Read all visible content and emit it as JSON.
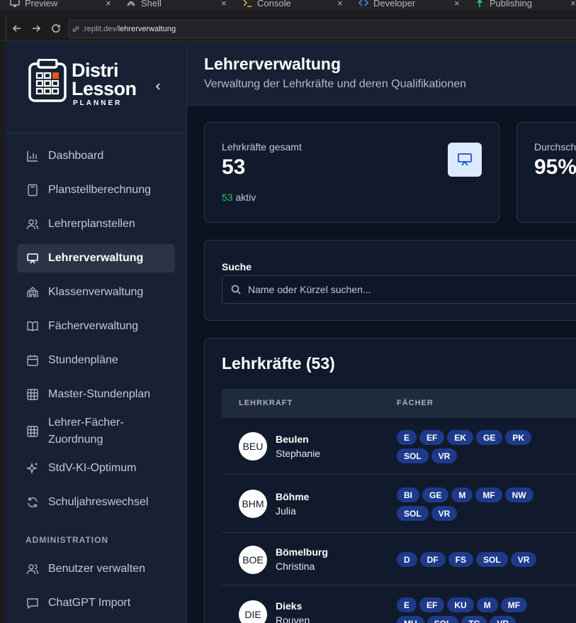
{
  "browser": {
    "tabs": [
      {
        "label": "Preview",
        "icon": "monitor-icon"
      },
      {
        "label": "Shell",
        "icon": "shell-icon"
      },
      {
        "label": "Console",
        "icon": "terminal-icon"
      },
      {
        "label": "Developer",
        "icon": "code-icon"
      },
      {
        "label": "Publishing",
        "icon": "publish-icon"
      }
    ],
    "close_glyph": "×",
    "url_prefix": ".replit.dev/",
    "url_path": "lehrerverwaltung"
  },
  "sidebar": {
    "brand_line1": "Distri",
    "brand_line2": "Lesson",
    "brand_line3": "PLANNER",
    "items": [
      {
        "label": "Dashboard",
        "icon": "bar-chart-icon"
      },
      {
        "label": "Planstellberechnung",
        "icon": "calculator-icon"
      },
      {
        "label": "Lehrerplanstellen",
        "icon": "users-icon"
      },
      {
        "label": "Lehrerverwaltung",
        "icon": "presentation-icon",
        "active": true
      },
      {
        "label": "Klassenverwaltung",
        "icon": "school-icon"
      },
      {
        "label": "Fächerverwaltung",
        "icon": "book-icon"
      },
      {
        "label": "Stundenpläne",
        "icon": "calendar-icon"
      },
      {
        "label": "Master-Stundenplan",
        "icon": "grid-icon"
      },
      {
        "label": "Lehrer-Fächer-Zuordnung",
        "icon": "grid-icon"
      },
      {
        "label": "StdV-KI-Optimum",
        "icon": "sparkles-icon"
      },
      {
        "label": "Schuljahreswechsel",
        "icon": "refresh-icon"
      }
    ],
    "admin_section": "ADMINISTRATION",
    "admin_items": [
      {
        "label": "Benutzer verwalten",
        "icon": "users-icon"
      },
      {
        "label": "ChatGPT Import",
        "icon": "message-icon"
      }
    ]
  },
  "page": {
    "title": "Lehrerverwaltung",
    "subtitle": "Verwaltung der Lehrkräfte und deren Qualifikationen"
  },
  "stats": [
    {
      "label": "Lehrkräfte gesamt",
      "value": "53",
      "sub_count": "53",
      "sub_text": " aktiv"
    },
    {
      "label": "Durchsch",
      "value": "95%"
    }
  ],
  "search": {
    "label": "Suche",
    "placeholder": "Name oder Kürzel suchen..."
  },
  "teachers": {
    "title": "Lehrkräfte (53)",
    "columns": [
      "LEHRKRAFT",
      "FÄCHER"
    ],
    "rows": [
      {
        "abbr": "BEU",
        "last": "Beulen",
        "first": "Stephanie",
        "subjects": [
          "E",
          "EF",
          "EK",
          "GE",
          "PK",
          "SOL",
          "VR"
        ]
      },
      {
        "abbr": "BHM",
        "last": "Böhme",
        "first": "Julia",
        "subjects": [
          "BI",
          "GE",
          "M",
          "MF",
          "NW",
          "SOL",
          "VR"
        ]
      },
      {
        "abbr": "BOE",
        "last": "Bömelburg",
        "first": "Christina",
        "subjects": [
          "D",
          "DF",
          "FS",
          "SOL",
          "VR"
        ]
      },
      {
        "abbr": "DIE",
        "last": "Dieks",
        "first": "Rouven",
        "subjects": [
          "E",
          "EF",
          "KU",
          "M",
          "MF",
          "MU",
          "SOL",
          "TC",
          "VR"
        ]
      }
    ]
  },
  "colors": {
    "accent_green": "#22c55e",
    "badge_blue": "#1e3a8a",
    "sidebar_bg": "#172133",
    "icon_bg": "#dbeafe"
  }
}
